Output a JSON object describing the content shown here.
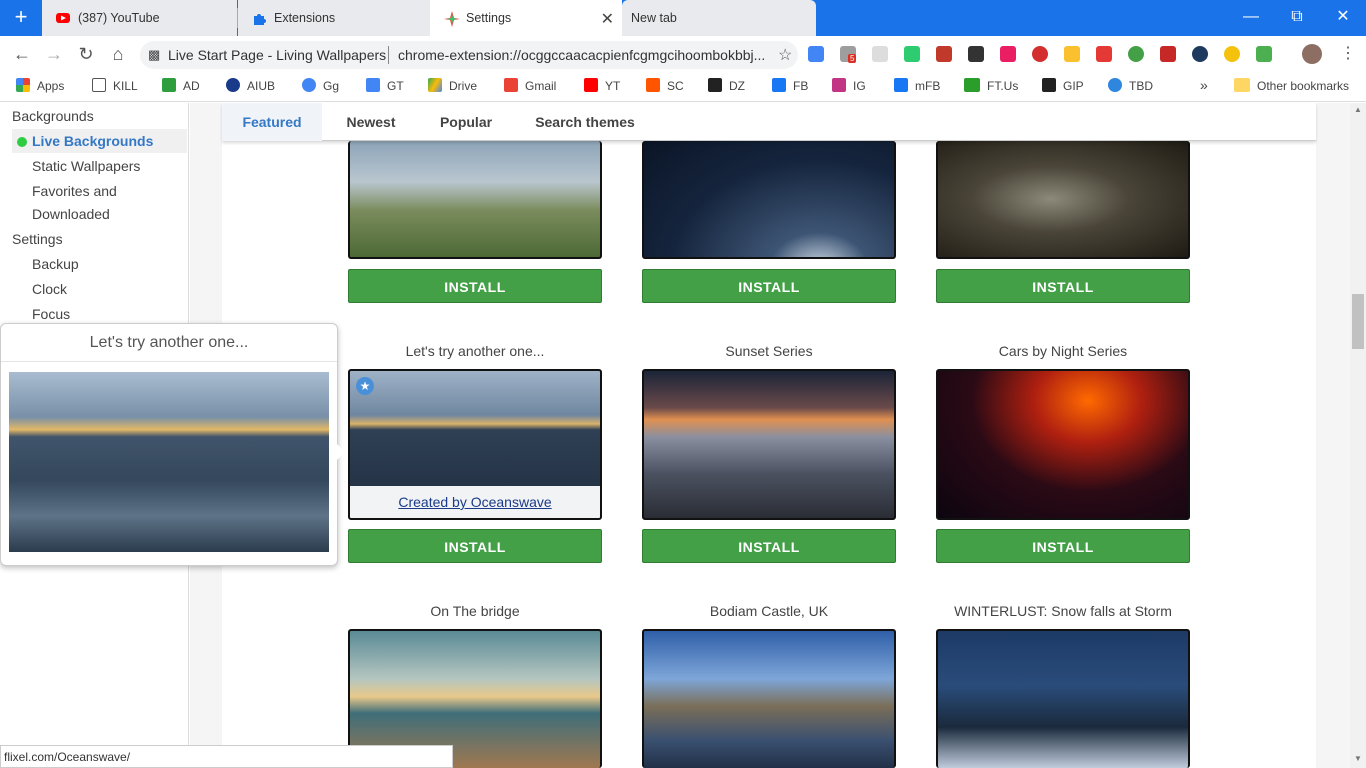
{
  "tabs": [
    {
      "label": "(387) YouTube",
      "icon": "youtube-icon"
    },
    {
      "label": "Extensions",
      "icon": "puzzle-icon"
    },
    {
      "label": "Settings",
      "icon": "settings-app-icon"
    },
    {
      "label": "New tab",
      "icon": ""
    }
  ],
  "omnibox": {
    "site_name": "Live Start Page - Living Wallpapers",
    "url": "chrome-extension://ocggccaacacpienfcgmgcihoombokbbj..."
  },
  "extension_badge": "5",
  "bookmarks": [
    {
      "label": "Apps",
      "color": "#ea4335"
    },
    {
      "label": "KILL",
      "color": "#ffffff"
    },
    {
      "label": "AD",
      "color": "#2e9e3e"
    },
    {
      "label": "AIUB",
      "color": "#1a3a8a"
    },
    {
      "label": "Gg",
      "color": "#4285f4"
    },
    {
      "label": "GT",
      "color": "#4285f4"
    },
    {
      "label": "Drive",
      "color": "#fbbc05"
    },
    {
      "label": "Gmail",
      "color": "#ea4335"
    },
    {
      "label": "YT",
      "color": "#ff0000"
    },
    {
      "label": "SC",
      "color": "#ff5500"
    },
    {
      "label": "DZ",
      "color": "#222222"
    },
    {
      "label": "FB",
      "color": "#1877f2"
    },
    {
      "label": "IG",
      "color": "#c13584"
    },
    {
      "label": "mFB",
      "color": "#1877f2"
    },
    {
      "label": "FT.Us",
      "color": "#2a9d2a"
    },
    {
      "label": "GIP",
      "color": "#222222"
    },
    {
      "label": "TBD",
      "color": "#2e86de"
    }
  ],
  "bookmarks_overflow": "»",
  "other_bookmarks": "Other bookmarks",
  "sidebar": {
    "backgrounds": "Backgrounds",
    "live_backgrounds": "Live Backgrounds",
    "static_wallpapers": "Static Wallpapers",
    "favorites": "Favorites and",
    "downloaded": "Downloaded",
    "settings": "Settings",
    "backup": "Backup",
    "clock": "Clock",
    "focus": "Focus"
  },
  "filter_tabs": [
    "Featured",
    "Newest",
    "Popular",
    "Search themes"
  ],
  "install_label": "INSTALL",
  "row2_captions": [
    "Let's try another one...",
    "Sunset Series",
    "Cars by Night Series"
  ],
  "row3_captions": [
    "On The bridge",
    "Bodiam Castle, UK",
    "WINTERLUST: Snow falls at Storm"
  ],
  "credit": "Created by Oceanswave",
  "popup_title": "Let's try another one...",
  "status_url": "flixel.com/Oceanswave/"
}
